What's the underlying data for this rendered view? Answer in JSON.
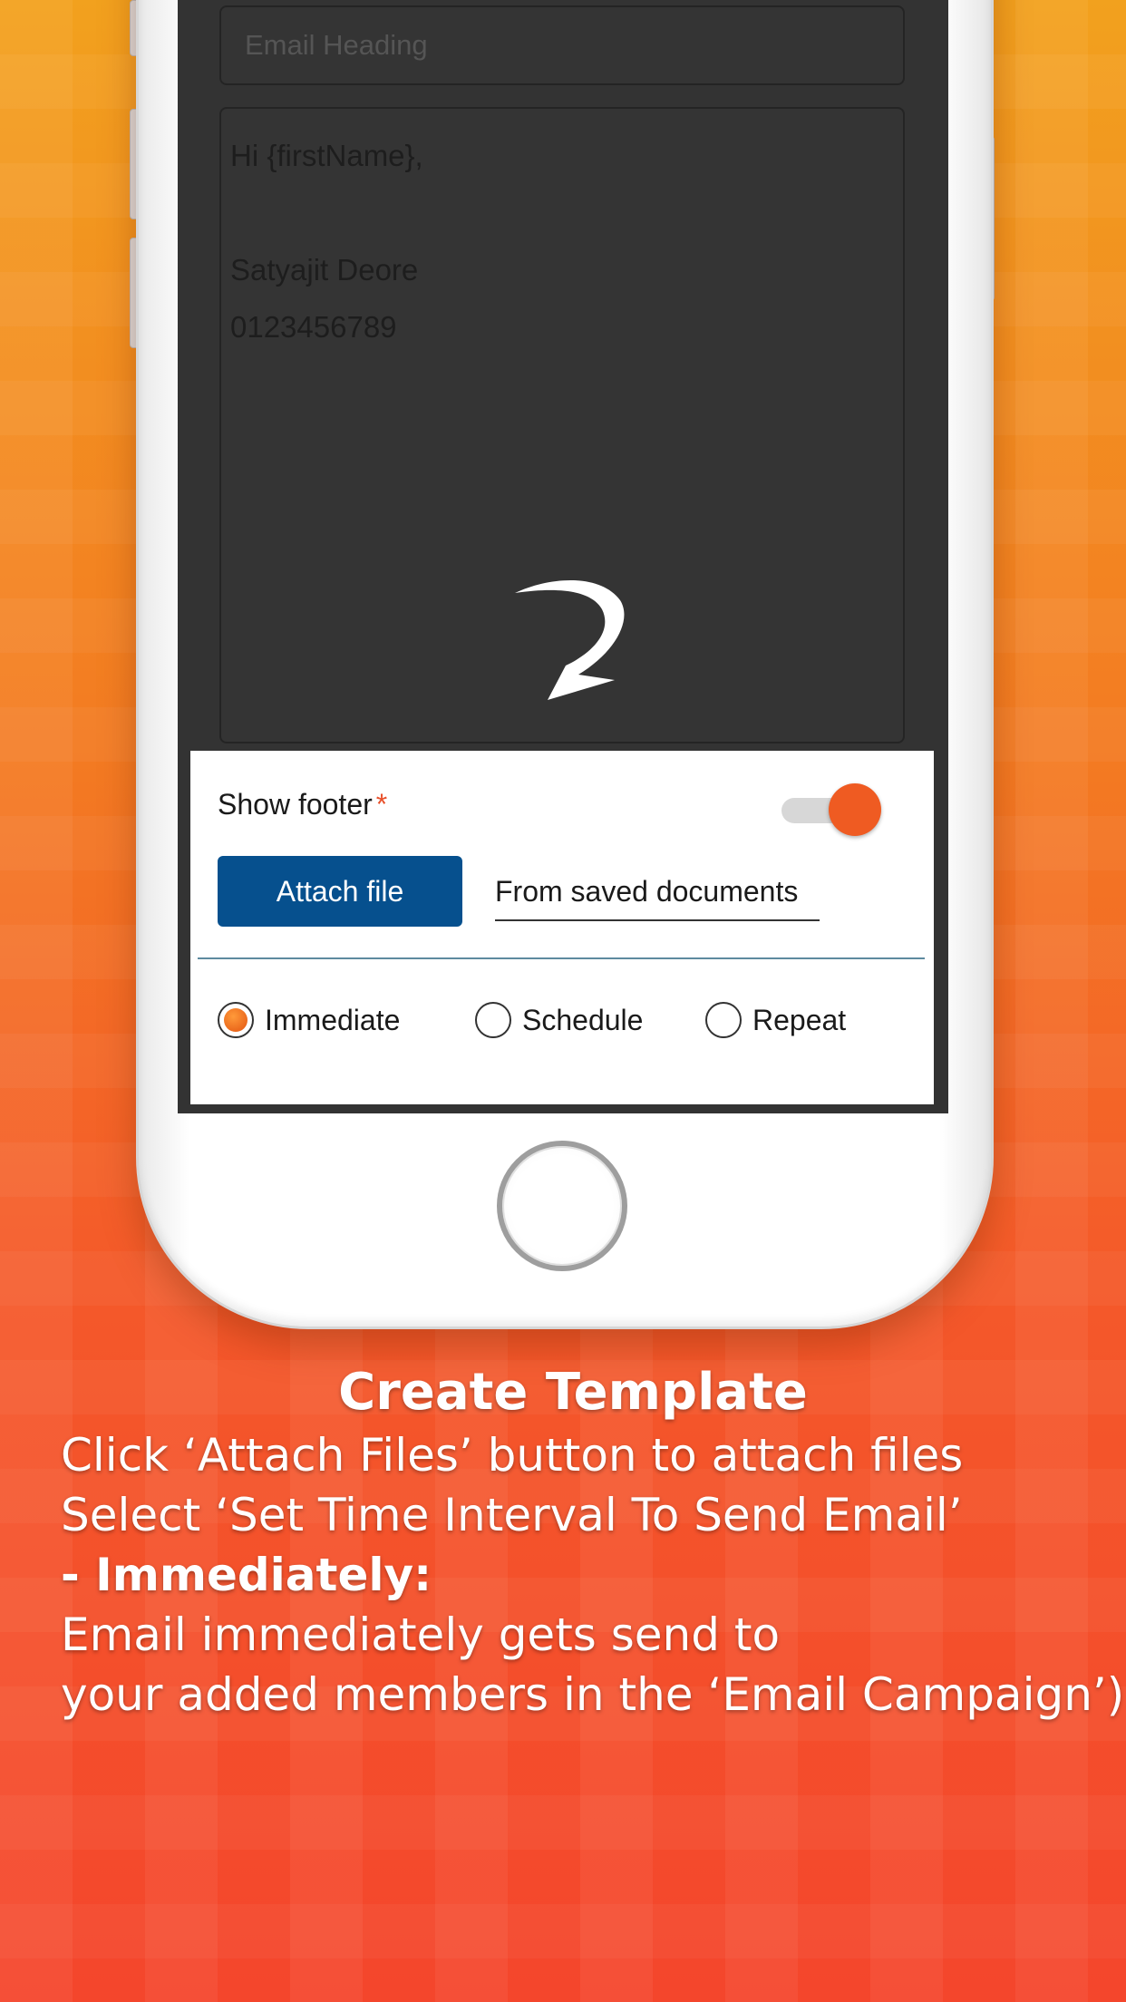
{
  "colors": {
    "accent_orange": "#ef5b22",
    "button_blue": "#06508e",
    "screen_dark": "#333333"
  },
  "email_form": {
    "heading_placeholder": "Email Heading",
    "body_lines": [
      "Hi {firstName},",
      "",
      "Satyajit Deore",
      "0123456789"
    ]
  },
  "footer": {
    "label": "Show footer",
    "required_mark": "*",
    "toggle_on": true
  },
  "attachments": {
    "attach_label": "Attach file",
    "saved_docs_label": "From saved documents"
  },
  "send_options": {
    "options": [
      "Immediate",
      "Schedule",
      "Repeat"
    ],
    "selected": "Immediate"
  },
  "caption": {
    "title": "Create Template",
    "lines": [
      "Click ‘Attach Files’ button to attach files",
      "Select ‘Set Time Interval To Send Email’",
      "- Immediately:",
      "Email immediately gets send to",
      "your added members in the ‘Email Campaign’)"
    ]
  }
}
